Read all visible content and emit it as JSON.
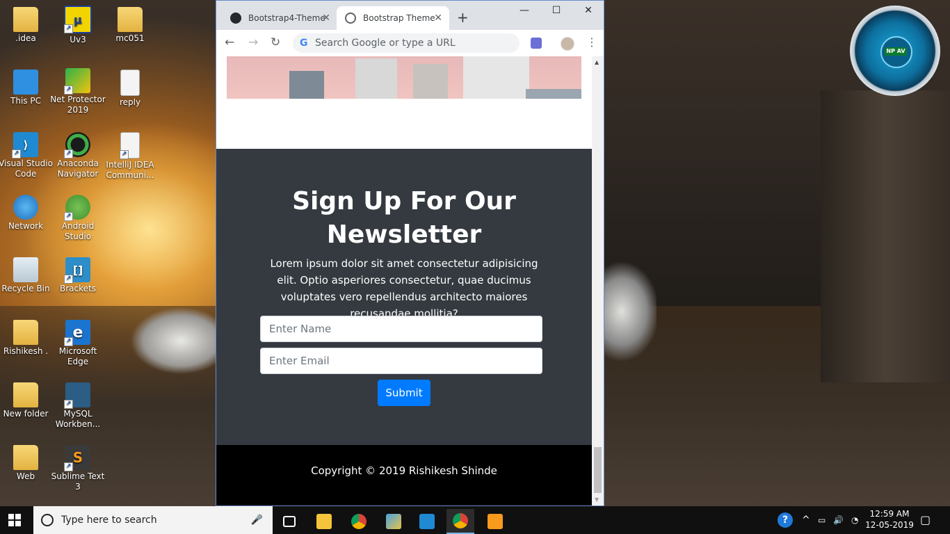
{
  "desktop": {
    "icons": [
      {
        "label": ".idea"
      },
      {
        "label": "Uv3"
      },
      {
        "label": "mc051"
      },
      {
        "label": "This PC"
      },
      {
        "label": "Net Protector 2019"
      },
      {
        "label": "reply"
      },
      {
        "label": "Visual Studio Code"
      },
      {
        "label": "Anaconda Navigator"
      },
      {
        "label": "IntelliJ IDEA Communi..."
      },
      {
        "label": "Network"
      },
      {
        "label": "Android Studio"
      },
      {
        "label": "Recycle Bin"
      },
      {
        "label": "Brackets"
      },
      {
        "label": "Rishikesh ."
      },
      {
        "label": "Microsoft Edge"
      },
      {
        "label": "New folder"
      },
      {
        "label": "MySQL Workben..."
      },
      {
        "label": "Web"
      },
      {
        "label": "Sublime Text 3"
      }
    ],
    "npav_badge": "NP AV"
  },
  "browser": {
    "tabs": [
      {
        "title": "Bootstrap4-Theme"
      },
      {
        "title": "Bootstrap Theme"
      }
    ],
    "close_glyph": "✕",
    "new_tab_glyph": "+",
    "window_controls": {
      "minimize": "—",
      "maximize": "☐",
      "close": "✕"
    },
    "omnibox_placeholder": "Search Google or type a URL",
    "omnibox_g": "G",
    "nav": {
      "back": "←",
      "forward": "→",
      "reload": "↻",
      "menu": "⋮"
    }
  },
  "page": {
    "newsletter": {
      "heading": "Sign Up For Our Newsletter",
      "body": "Lorem ipsum dolor sit amet consectetur adipisicing elit. Optio asperiores consectetur, quae ducimus voluptates vero repellendus architecto maiores recusandae mollitia?",
      "name_placeholder": "Enter Name",
      "email_placeholder": "Enter Email",
      "submit_label": "Submit"
    },
    "footer": {
      "copyright": "Copyright © 2019 Rishikesh Shinde"
    }
  },
  "taskbar": {
    "search_placeholder": "Type here to search",
    "apps": [
      "task-view",
      "file-explorer",
      "chrome",
      "control-panel",
      "visual-studio-code",
      "chrome-active",
      "sublime-text"
    ],
    "clock_time": "12:59 AM",
    "clock_date": "12-05-2019",
    "help_glyph": "?",
    "tray_chevron": "^"
  },
  "colors": {
    "newsletter_bg": "#343a40",
    "footer_bg": "#000000",
    "primary": "#007bff",
    "taskbar_bg": "#101010"
  }
}
